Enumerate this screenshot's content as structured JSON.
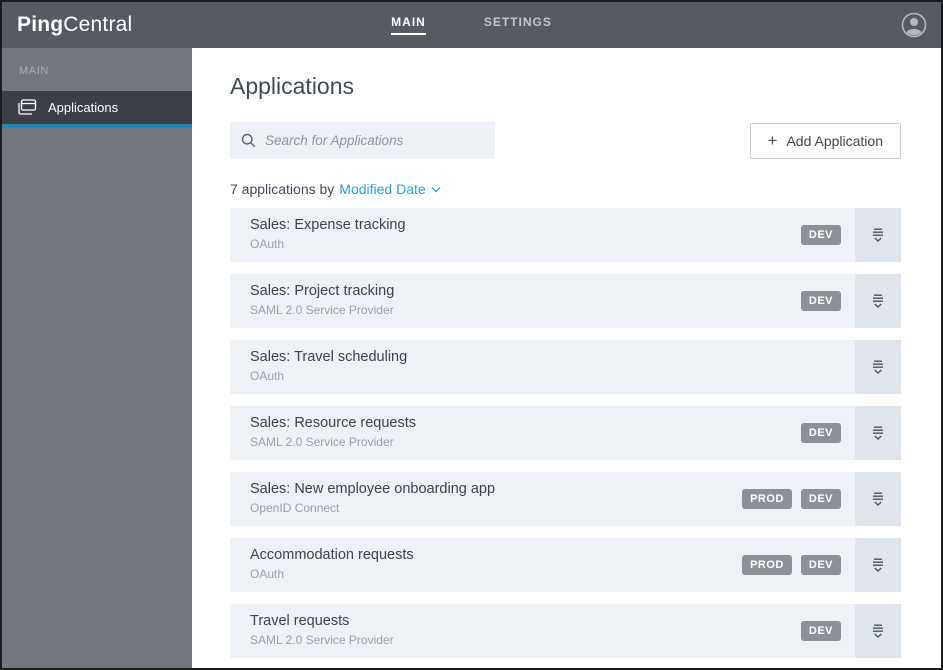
{
  "app": {
    "brand_bold": "Ping",
    "brand_regular": "Central"
  },
  "topnav": {
    "items": [
      {
        "label": "MAIN",
        "active": true
      },
      {
        "label": "SETTINGS",
        "active": false
      }
    ]
  },
  "sidebar": {
    "section_label": "MAIN",
    "items": [
      {
        "label": "Applications",
        "active": true,
        "icon": "applications-icon"
      }
    ]
  },
  "main": {
    "title": "Applications",
    "search": {
      "placeholder": "Search for Applications",
      "icon": "search-icon"
    },
    "add_button": {
      "plus": "+",
      "label": "Add Application"
    },
    "summary": {
      "count_text": "7 applications by",
      "sort_label": "Modified Date",
      "sort_icon": "chevron-down-icon"
    },
    "applications": [
      {
        "name": "Sales: Expense tracking",
        "type": "OAuth",
        "badges": [
          "DEV"
        ]
      },
      {
        "name": "Sales: Project tracking",
        "type": "SAML 2.0 Service Provider",
        "badges": [
          "DEV"
        ]
      },
      {
        "name": "Sales: Travel scheduling",
        "type": "OAuth",
        "badges": []
      },
      {
        "name": "Sales: Resource requests",
        "type": "SAML 2.0 Service Provider",
        "badges": [
          "DEV"
        ]
      },
      {
        "name": "Sales: New employee onboarding app",
        "type": "OpenID Connect",
        "badges": [
          "PROD",
          "DEV"
        ]
      },
      {
        "name": "Accommodation requests",
        "type": "OAuth",
        "badges": [
          "PROD",
          "DEV"
        ]
      },
      {
        "name": "Travel requests",
        "type": "SAML 2.0 Service Provider",
        "badges": [
          "DEV"
        ]
      }
    ]
  },
  "colors": {
    "topbar": "#565a63",
    "sidebar": "#74777e",
    "sidebar_active": "#3c4046",
    "active_underline": "#1d87c1",
    "accent_blue": "#2b9fd8",
    "row_background": "#eef1f5",
    "expand_background": "#dfe5ea",
    "badge_background": "#8d9197",
    "heading_text": "#3f4b59"
  }
}
